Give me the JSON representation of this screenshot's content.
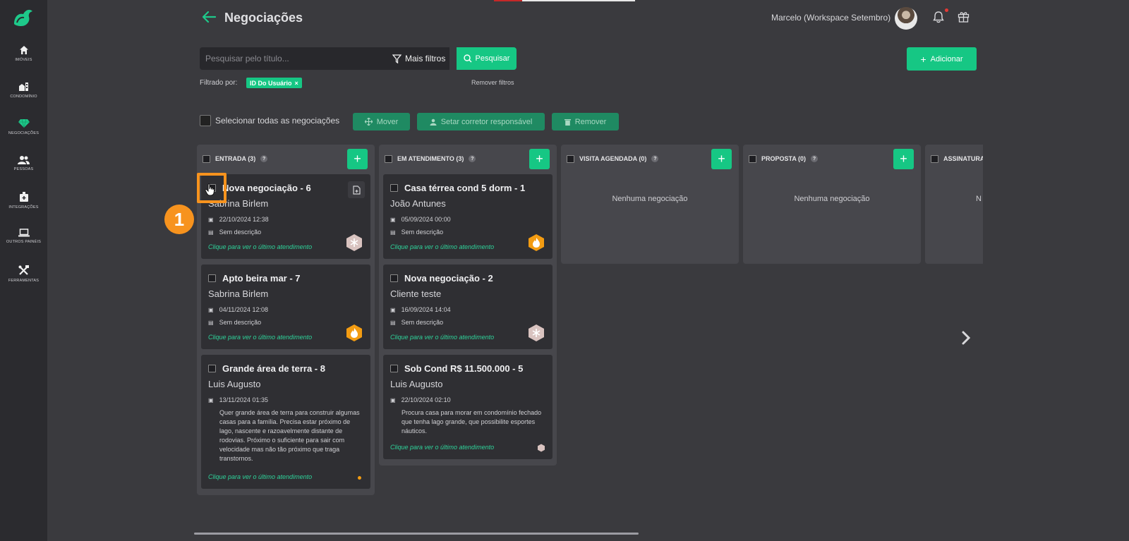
{
  "sidebar": {
    "items": [
      {
        "label": "IMÓVEIS",
        "icon": "home-icon"
      },
      {
        "label": "CONDOMÍNIO",
        "icon": "building-icon"
      },
      {
        "label": "NEGOCIAÇÕES",
        "icon": "diamond-icon"
      },
      {
        "label": "PESSOAS",
        "icon": "people-icon"
      },
      {
        "label": "INTEGRAÇÕES",
        "icon": "integration-icon"
      },
      {
        "label": "OUTROS PAINÉIS",
        "icon": "laptop-icon"
      },
      {
        "label": "FERRAMENTAS",
        "icon": "tools-icon"
      }
    ]
  },
  "header": {
    "title": "Negociações",
    "user_name": "Marcelo (Workspace Setembro)"
  },
  "search": {
    "placeholder": "Pesquisar pelo título...",
    "more_filters_label": "Mais filtros",
    "search_label": "Pesquisar",
    "add_label": "Adicionar"
  },
  "filters": {
    "label": "Filtrado por:",
    "chip": "ID Do Usuário",
    "remove": "Remover filtros"
  },
  "bulk": {
    "select_all": "Selecionar todas as negociações",
    "move": "Mover",
    "set_broker": "Setar corretor responsável",
    "remove": "Remover"
  },
  "columns": [
    {
      "title": "ENTRADA",
      "count": "(3)",
      "cards": [
        {
          "title": "Nova negociação - 6",
          "client": "Sabrina Birlem",
          "date": "22/10/2024 12:38",
          "desc": "Sem descrição",
          "link": "Clique para ver o último atendimento"
        },
        {
          "title": "Apto beira mar - 7",
          "client": "Sabrina Birlem",
          "date": "04/11/2024 12:08",
          "desc": "Sem descrição",
          "link": "Clique para ver o último atendimento"
        },
        {
          "title": "Grande área de terra - 8",
          "client": "Luis Augusto",
          "date": "13/11/2024 01:35",
          "desc": "Quer grande área de terra para construir algumas casas para a família. Precisa estar próximo de lago, nascente e razoavelmente distante de rodovias. Próximo o suficiente para sair com velocidade mas não tão próximo que traga transtornos.",
          "link": "Clique para ver o último atendimento"
        }
      ]
    },
    {
      "title": "EM ATENDIMENTO",
      "count": "(3)",
      "cards": [
        {
          "title": "Casa térrea cond 5 dorm - 1",
          "client": "João Antunes",
          "date": "05/09/2024 00:00",
          "desc": "Sem descrição",
          "link": "Clique para ver o último atendimento"
        },
        {
          "title": "Nova negociação - 2",
          "client": "Cliente teste",
          "date": "16/09/2024 14:04",
          "desc": "Sem descrição",
          "link": "Clique para ver o último atendimento"
        },
        {
          "title": "Sob Cond R$ 11.500.000 - 5",
          "client": "Luis Augusto",
          "date": "22/10/2024 02:10",
          "desc": "Procura casa para morar em condomínio fechado que tenha lago grande, que possibilite esportes náuticos.",
          "link": "Clique para ver o último atendimento"
        }
      ]
    },
    {
      "title": "VISITA AGENDADA",
      "count": "(0)",
      "empty": "Nenhuma negociação"
    },
    {
      "title": "PROPOSTA",
      "count": "(0)",
      "empty": "Nenhuma negociação"
    },
    {
      "title": "ASSINATURA",
      "count": "",
      "empty": "N"
    }
  ],
  "tutorial": {
    "step": "1"
  },
  "colors": {
    "accent": "#16c784",
    "highlight": "#f7931e",
    "fire": "#f39c12"
  }
}
